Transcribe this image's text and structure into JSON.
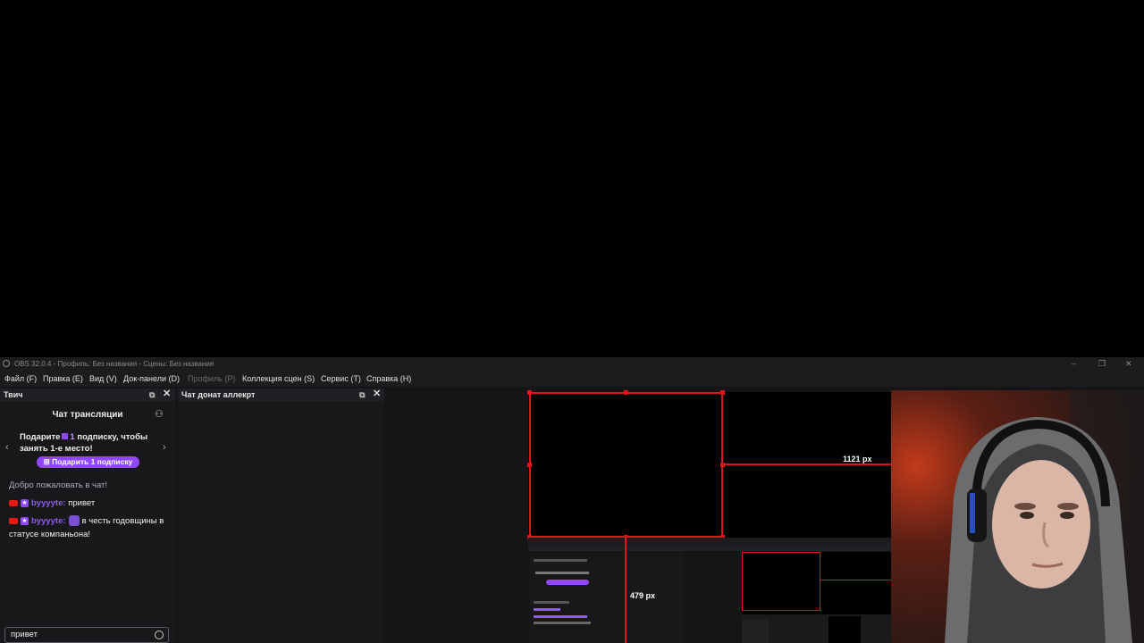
{
  "window": {
    "title": "OBS 32.0.4 - Профиль: Без названия - Сцены: Без названия",
    "controls": [
      "–",
      "❐",
      "✕"
    ]
  },
  "menu": [
    {
      "label": "Файл (F)"
    },
    {
      "label": "Правка (E)"
    },
    {
      "label": "Вид (V)"
    },
    {
      "label": "Док-панели (D)"
    },
    {
      "label": "Профиль (P)"
    },
    {
      "label": "Коллекция сцен (S)"
    },
    {
      "label": "Сервис (T)"
    },
    {
      "label": "Справка (H)"
    }
  ],
  "docks": {
    "twitch": {
      "title": "Твич",
      "float_icon": "⧉",
      "close_icon": "✕",
      "chat": {
        "title": "Чат трансляции",
        "promo": {
          "text_pre": "Подарите",
          "count": "1",
          "text_post": "подписку, чтобы занять 1-е место!",
          "button": "Подарить 1 подписку"
        },
        "welcome": "Добро пожаловать в чат!",
        "messages": [
          {
            "user": "byyyyte",
            "text": "привет"
          },
          {
            "user": "byyyyte",
            "text": "в честь годовщины в статусе компаньона!"
          }
        ],
        "input_value": "привет"
      }
    },
    "donate": {
      "title": "Чат донат аллекрт",
      "float_icon": "⧉",
      "close_icon": "✕"
    }
  },
  "preview": {
    "dimension_width": "1121 px",
    "dimension_height": "479 px"
  },
  "colors": {
    "accent": "#9147ff",
    "selection": "#e2141b",
    "background": "#18181b"
  }
}
